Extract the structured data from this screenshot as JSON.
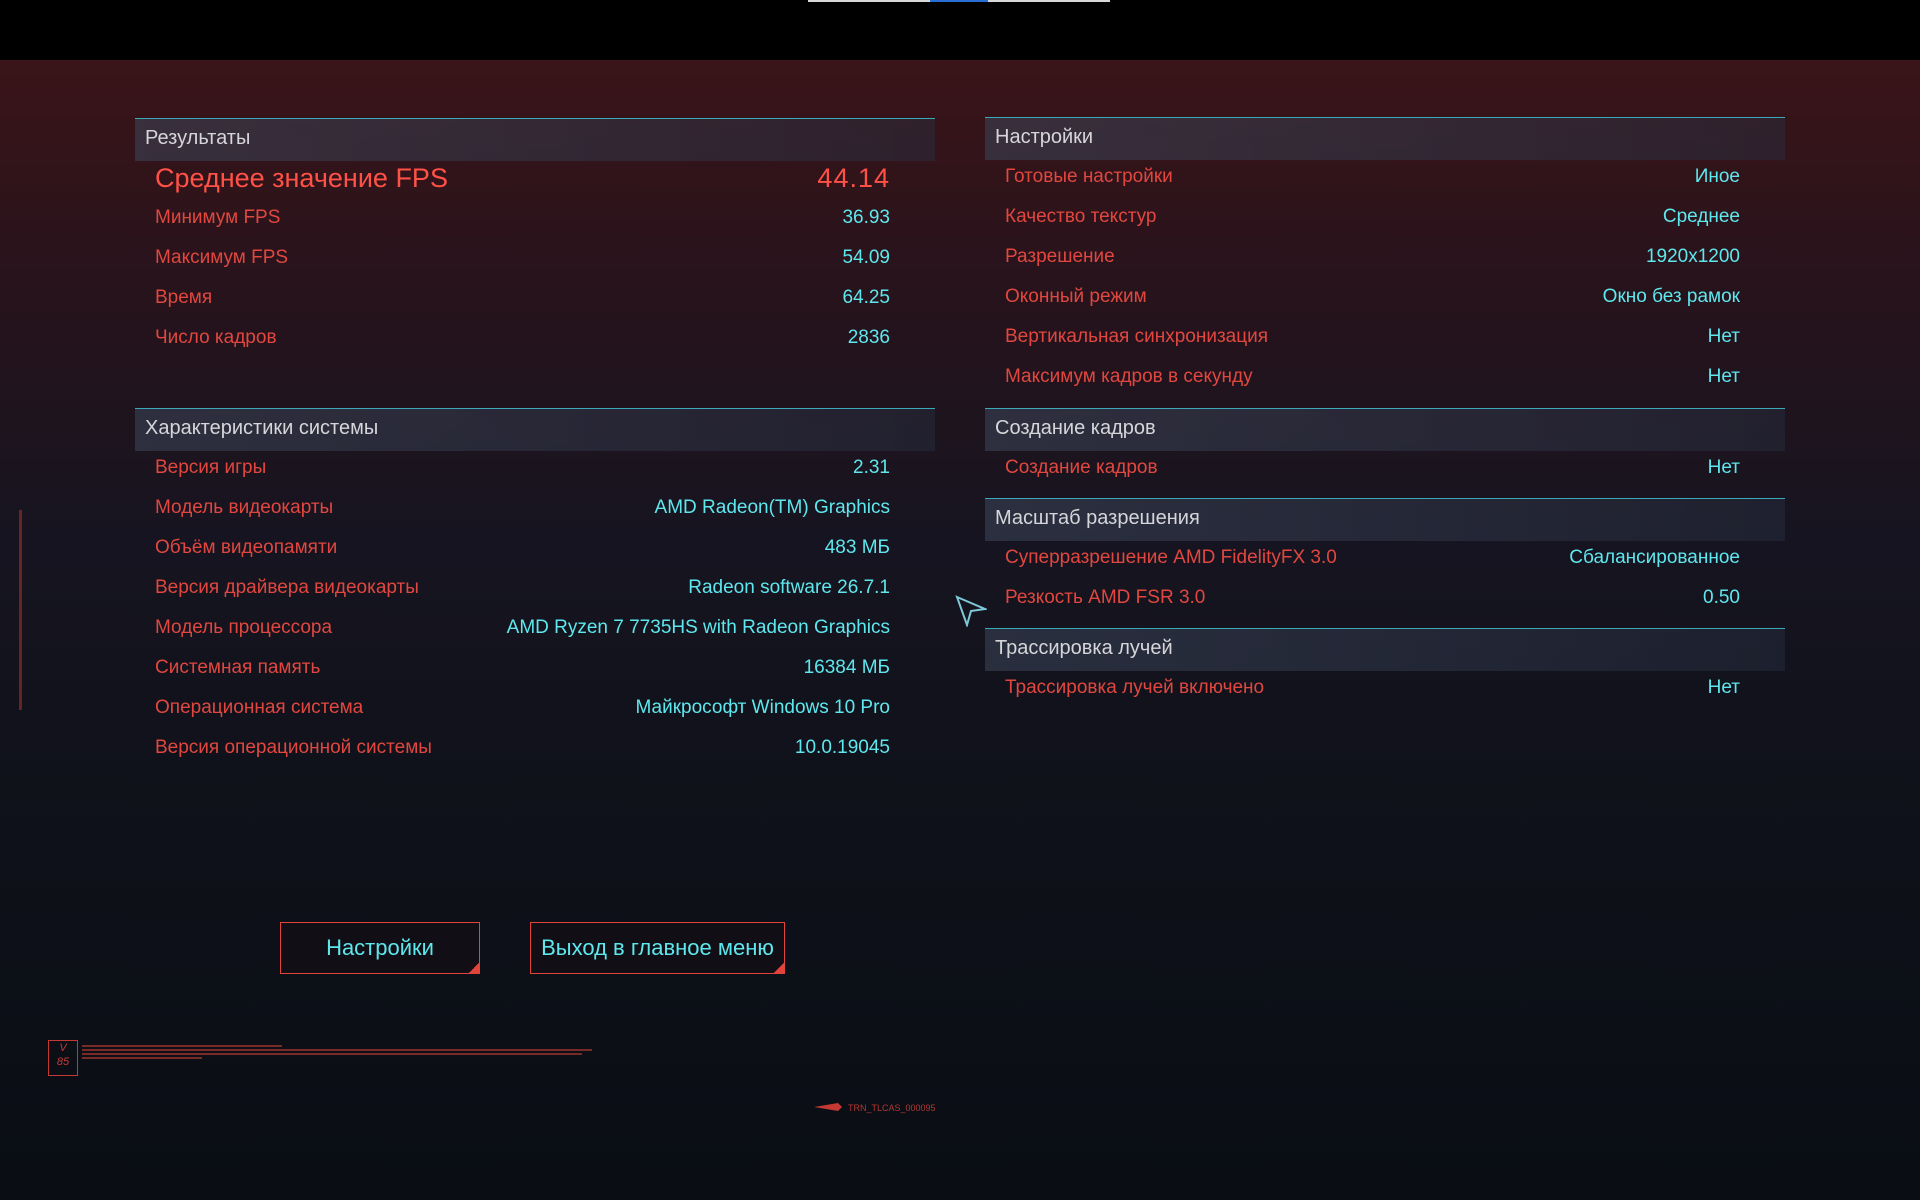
{
  "results": {
    "title": "Результаты",
    "avg_fps": {
      "label": "Среднее значение FPS",
      "value": "44.14"
    },
    "rows": [
      {
        "label": "Минимум FPS",
        "value": "36.93"
      },
      {
        "label": "Максимум FPS",
        "value": "54.09"
      },
      {
        "label": "Время",
        "value": "64.25"
      },
      {
        "label": "Число кадров",
        "value": "2836"
      }
    ]
  },
  "system": {
    "title": "Характеристики системы",
    "rows": [
      {
        "label": "Версия игры",
        "value": "2.31"
      },
      {
        "label": "Модель видеокарты",
        "value": "AMD Radeon(TM) Graphics"
      },
      {
        "label": "Объём видеопамяти",
        "value": "483 МБ"
      },
      {
        "label": "Версия драйвера видеокарты",
        "value": "Radeon software 26.7.1"
      },
      {
        "label": "Модель процессора",
        "value": "AMD Ryzen 7 7735HS with Radeon Graphics"
      },
      {
        "label": "Системная память",
        "value": "16384 МБ"
      },
      {
        "label": "Операционная система",
        "value": "Майкрософт Windows 10 Pro"
      },
      {
        "label": "Версия операционной системы",
        "value": "10.0.19045"
      }
    ]
  },
  "settings": {
    "title": "Настройки",
    "rows": [
      {
        "label": "Готовые настройки",
        "value": "Иное"
      },
      {
        "label": "Качество текстур",
        "value": "Среднее"
      },
      {
        "label": "Разрешение",
        "value": "1920x1200"
      },
      {
        "label": "Оконный режим",
        "value": "Окно без рамок"
      },
      {
        "label": "Вертикальная синхронизация",
        "value": "Нет"
      },
      {
        "label": "Максимум кадров в секунду",
        "value": "Нет"
      }
    ]
  },
  "frame_gen": {
    "title": "Создание кадров",
    "rows": [
      {
        "label": "Создание кадров",
        "value": "Нет"
      }
    ]
  },
  "scaling": {
    "title": "Масштаб разрешения",
    "rows": [
      {
        "label": "Суперразрешение AMD FidelityFX 3.0",
        "value": "Сбалансированное"
      },
      {
        "label": "Резкость AMD FSR 3.0",
        "value": "0.50"
      }
    ]
  },
  "raytracing": {
    "title": "Трассировка лучей",
    "rows": [
      {
        "label": "Трассировка лучей включено",
        "value": "Нет"
      }
    ]
  },
  "buttons": {
    "settings": "Настройки",
    "exit": "Выход в главное меню"
  },
  "decor": {
    "badge": "V\n85",
    "footer_code": "TRN_TLCAS_000095"
  },
  "colors": {
    "label": "#e2473f",
    "value": "#5ee8ee",
    "accent_line": "#3aaabb"
  }
}
